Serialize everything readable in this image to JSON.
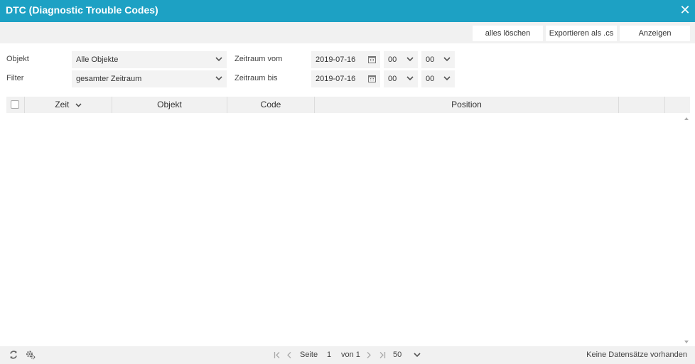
{
  "window": {
    "title": "DTC (Diagnostic Trouble Codes)",
    "close_icon": "close-icon"
  },
  "toolbar": {
    "clear_all_label": "alles löschen",
    "export_label": "Exportieren als .cs",
    "show_label": "Anzeigen"
  },
  "filters": {
    "object_label": "Objekt",
    "object_value": "Alle Objekte",
    "filter_label": "Filter",
    "filter_value": "gesamter Zeitraum",
    "from_label": "Zeitraum vom",
    "from_date": "2019-07-16",
    "from_hour": "00",
    "from_minute": "00",
    "to_label": "Zeitraum bis",
    "to_date": "2019-07-16",
    "to_hour": "00",
    "to_minute": "00"
  },
  "table": {
    "columns": [
      "Zeit",
      "Objekt",
      "Code",
      "Position"
    ],
    "sort_column": "Zeit",
    "sort_direction": "descending",
    "rows": []
  },
  "footer": {
    "refresh_icon": "refresh-icon",
    "settings_icon": "settings-gear-icon",
    "page_label": "Seite",
    "page_number": "1",
    "of_label": "von 1",
    "page_size": "50",
    "status": "Keine Datensätze vorhanden"
  },
  "colors": {
    "titlebar": "#1da1c4",
    "panel": "#f1f1f1",
    "field": "#f3f3f3"
  }
}
